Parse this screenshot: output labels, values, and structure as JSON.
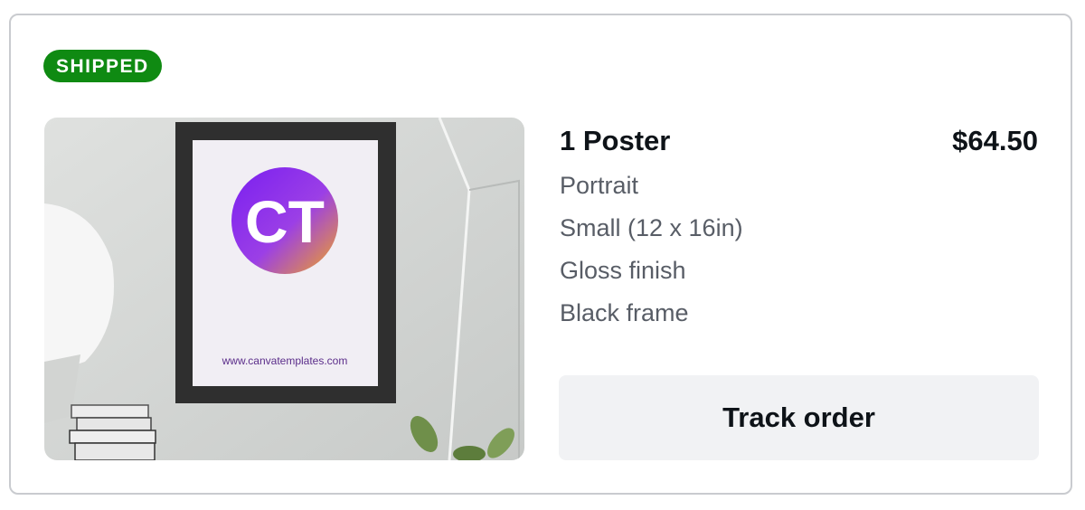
{
  "order": {
    "status_badge": "SHIPPED",
    "item_title": "1 Poster",
    "price": "$64.50",
    "options": [
      "Portrait",
      "Small (12 x 16in)",
      "Gloss finish",
      "Black frame"
    ],
    "track_button_label": "Track order",
    "product_image": {
      "logo_text": "CT",
      "website_text": "www.canvatemplates.com"
    }
  },
  "colors": {
    "badge_bg": "#0f8a12",
    "button_bg": "#f1f2f4",
    "text_primary": "#0e1318",
    "text_secondary": "#585d66"
  }
}
